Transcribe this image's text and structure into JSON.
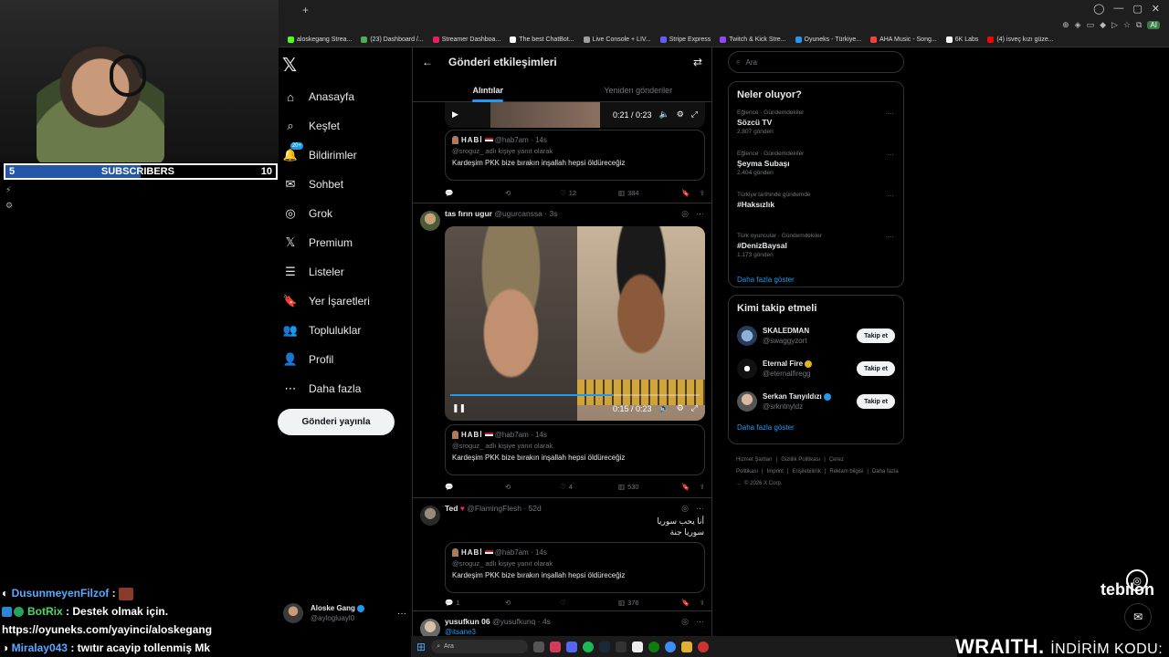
{
  "overlay": {
    "subscribers": {
      "current": "5",
      "label": "SUBSCRIBERS",
      "goal": "10",
      "progress": 0.5
    },
    "chat": [
      {
        "user": "DusunmeyenFilzof",
        "sep": " :",
        "text": ""
      },
      {
        "user": "BotRix",
        "sep": " :",
        "text": " Destek olmak için."
      },
      {
        "user": "",
        "sep": "",
        "text": "https://oyuneks.com/yayinci/aloskegang"
      },
      {
        "user": "Miralay043",
        "sep": " :",
        "text": " twıtır acayip tollenmiş Mk"
      }
    ],
    "brand": "tebilon",
    "sponsor_brand": "WRAITH.",
    "sponsor_text": "İNDİRİM KODU:"
  },
  "browser": {
    "bookmarks": [
      "aloskegang Strea...",
      "(23) Dashboard /...",
      "Streamer Dashboa...",
      "The best ChatBot...",
      "Live Console + LIV...",
      "Stripe Express",
      "Twitch & Kick Stre...",
      "Oyuneks - Türkiye...",
      "AHA Music - Song...",
      "6K Labs",
      "(4) isveç kızı güze..."
    ],
    "ai_label": "AI"
  },
  "nav": {
    "items": [
      {
        "label": "Anasayfa",
        "icon": "home-icon"
      },
      {
        "label": "Keşfet",
        "icon": "search-icon"
      },
      {
        "label": "Bildirimler",
        "icon": "bell-icon",
        "badge": "20+"
      },
      {
        "label": "Sohbet",
        "icon": "mail-icon"
      },
      {
        "label": "Grok",
        "icon": "grok-icon"
      },
      {
        "label": "Premium",
        "icon": "x-icon"
      },
      {
        "label": "Listeler",
        "icon": "list-icon"
      },
      {
        "label": "Yer İşaretleri",
        "icon": "bookmark-icon"
      },
      {
        "label": "Topluluklar",
        "icon": "communities-icon"
      },
      {
        "label": "Profil",
        "icon": "profile-icon"
      },
      {
        "label": "Daha fazla",
        "icon": "more-circle-icon"
      }
    ],
    "post_button": "Gönderi yayınla",
    "account": {
      "name": "Aloske Gang",
      "handle": "@aylogluayl0"
    }
  },
  "main": {
    "title": "Gönderi etkileşimleri",
    "tabs": [
      "Alıntılar",
      "Yeniden gönderiler"
    ],
    "video1": {
      "time": "0:21 / 0:23"
    },
    "posts": [
      {
        "quote": {
          "name": "HABİ",
          "handle": "@hab7am",
          "time": "· 14s",
          "reply": "@sroguz_ adlı kişiye yanıt olarak",
          "text": "Kardeşim PKK bize bırakın inşallah hepsi  öldüreceğiz"
        },
        "actions": {
          "replies": "",
          "reposts": "",
          "likes": "12",
          "views": "384"
        }
      },
      {
        "name": "tas fırın ugur",
        "handle": "@ugurcanssa",
        "time": "· 3s",
        "video_time": "0:15 / 0:23",
        "video_progress": 0.65,
        "quote": {
          "name": "HABİ",
          "handle": "@hab7am",
          "time": "· 14s",
          "reply": "@sroguz_ adlı kişiye yanıt olarak",
          "text": "Kardeşim PKK bize bırakın inşallah hepsi  öldüreceğiz"
        },
        "actions": {
          "replies": "",
          "reposts": "",
          "likes": "4",
          "views": "530"
        }
      },
      {
        "name": "Ted",
        "handle": "@FlamingFlesh",
        "time": "· 52d",
        "arabic_line1": "أنا يحب سوريا",
        "arabic_line2": "سوريا جنة",
        "quote": {
          "name": "HABİ",
          "handle": "@hab7am",
          "time": "· 14s",
          "reply": "@sroguz_ adlı kişiye yanıt olarak",
          "text": "Kardeşim PKK bize bırakın inşallah hepsi  öldüreceğiz"
        },
        "actions": {
          "replies": "1",
          "reposts": "",
          "likes": "",
          "views": "376"
        }
      },
      {
        "name": "yusufkun 06",
        "handle": "@yusufkunq",
        "time": "· 4s",
        "reply_to": "@itsane3"
      }
    ]
  },
  "sidebar": {
    "search_placeholder": "Ara",
    "trends_title": "Neler oluyor?",
    "trends": [
      {
        "meta": "Eğlence · Gündemdekiler",
        "name": "Sözcü TV",
        "count": "2.807 gönderi"
      },
      {
        "meta": "Eğlence · Gündemdekiler",
        "name": "Şeyma Subaşı",
        "count": "2.404 gönderi"
      },
      {
        "meta": "Türkiye tarihinde gündemde",
        "name": "#Haksızlık",
        "count": ""
      },
      {
        "meta": "Türk oyuncular · Gündemdekiler",
        "name": "#DenizBaysal",
        "count": "1.173 gönderi"
      }
    ],
    "show_more": "Daha fazla göster",
    "follow_title": "Kimi takip etmeli",
    "follow": [
      {
        "name": "SKALEDMAN",
        "handle": "@swaggyzort",
        "verified": ""
      },
      {
        "name": "Eternal Fire",
        "handle": "@eternalfiregg",
        "verified": "gold"
      },
      {
        "name": "Serkan Tanyıldızı",
        "handle": "@srkntnyldz",
        "verified": "blue"
      }
    ],
    "follow_button": "Takip et",
    "footer": [
      "Hizmet Şartları",
      "|",
      "Gizlilik Politikası",
      "|",
      "Çerez Politikası",
      "|",
      "Imprint",
      "|",
      "Erişilebilirlik",
      "|",
      "Reklam bilgisi",
      "|",
      "Daha fazla ...",
      "© 2026 X Corp."
    ]
  },
  "taskbar": {
    "search": "Ara"
  },
  "colors": {
    "accent": "#1d9bf0",
    "background": "#000000",
    "border": "#2f3336",
    "muted": "#71767b"
  }
}
